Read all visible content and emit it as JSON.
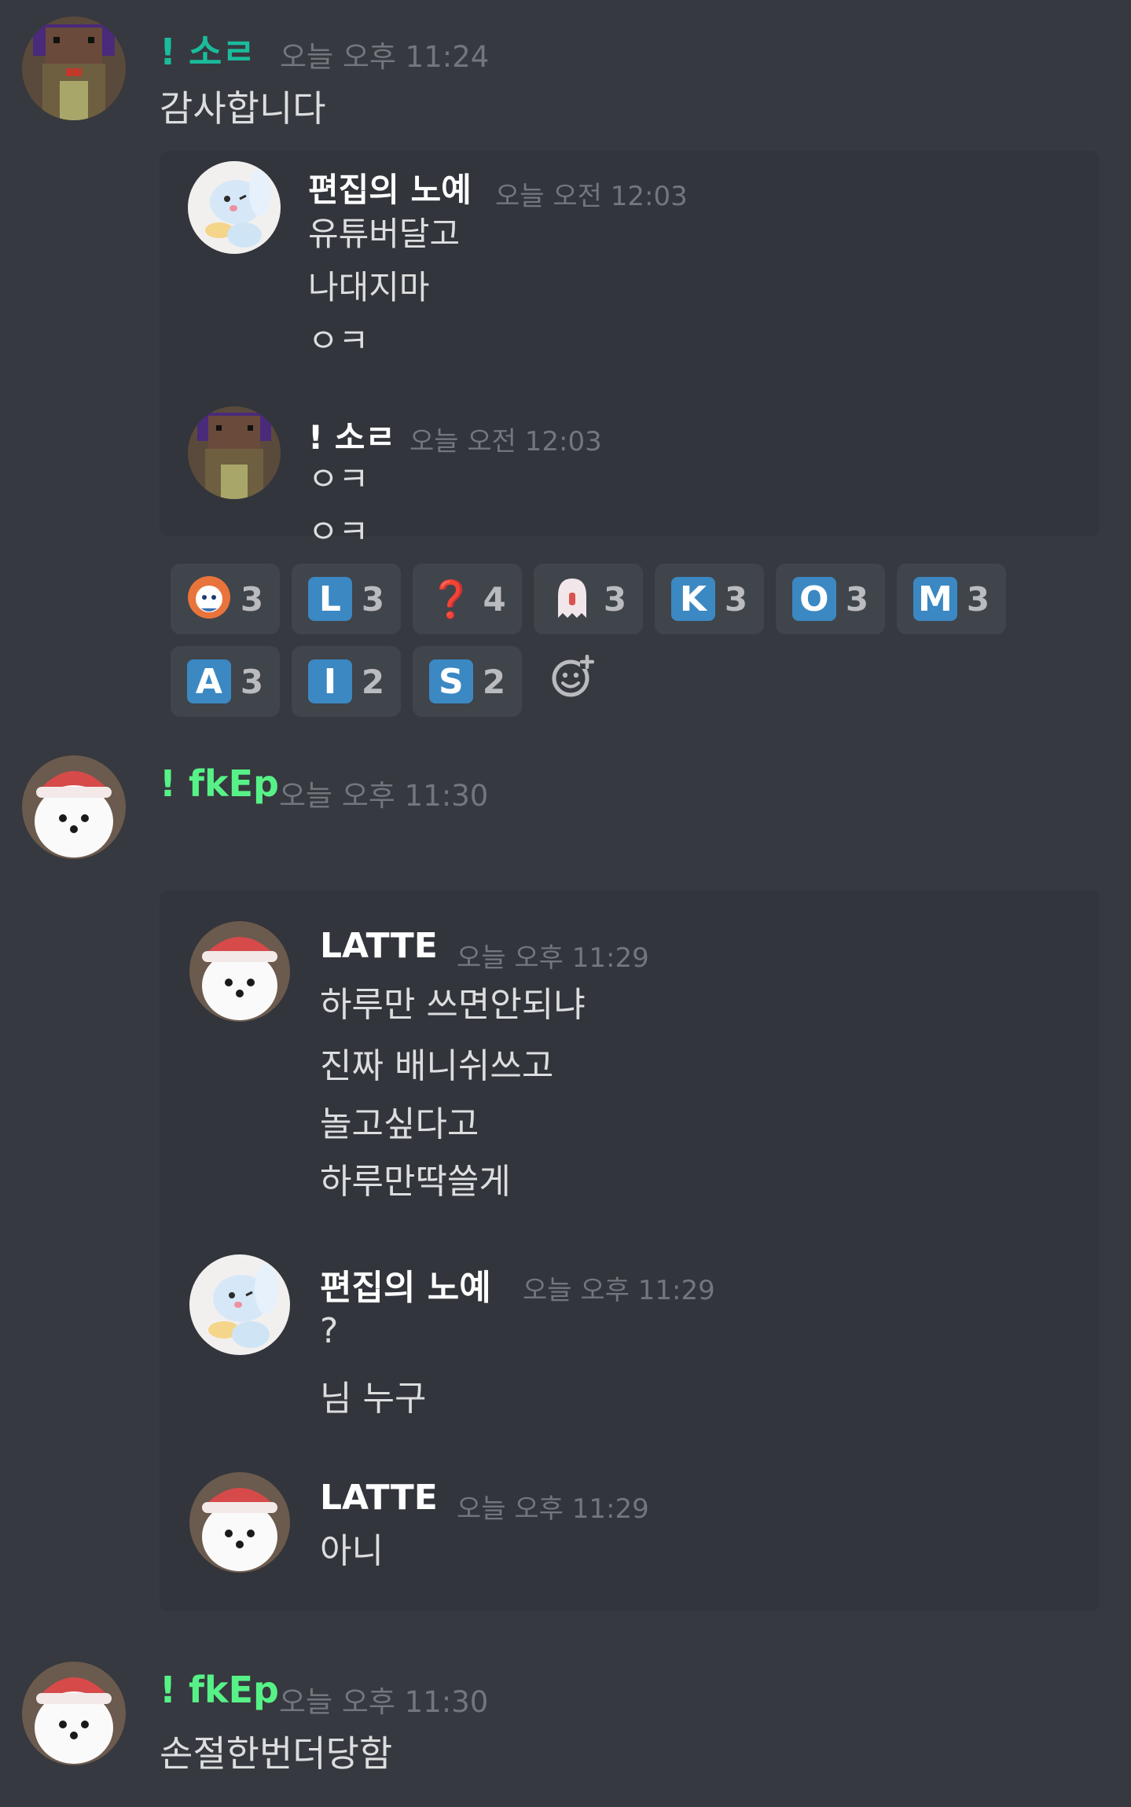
{
  "colors": {
    "background": "#36393f",
    "embed_bg": "#32353b",
    "reaction_bg": "#40444b",
    "timestamp": "#72767d",
    "text": "#dcddde",
    "white_name": "#ffffff",
    "sor_name": "#1abc9c",
    "fkep_name": "#57f287",
    "reaction_tile": "#3b88c3",
    "question_red": "#dd2e44"
  },
  "messages": [
    {
      "author": "! 소ㄹ",
      "timestamp": "오늘 오후 11:24",
      "lines": [
        "감사합니다"
      ],
      "avatar": "pixel-avatar"
    },
    {
      "author": "! fkEp",
      "timestamp": "오늘 오후 11:30",
      "lines": [],
      "avatar": "pomeranian-avatar"
    },
    {
      "author": "! fkEp",
      "timestamp": "오늘 오후 11:30",
      "lines": [
        "손절한번더당함"
      ],
      "avatar": "pomeranian-avatar"
    }
  ],
  "embed1": [
    {
      "author": "편집의 노예",
      "timestamp": "오늘 오전 12:03",
      "lines": [
        "유튜버달고",
        "나대지마",
        "ㅇㅋ"
      ]
    },
    {
      "author": "! 소ㄹ",
      "timestamp": "오늘 오전 12:03",
      "lines": [
        "ㅇㅋ",
        "ㅇㅋ"
      ]
    }
  ],
  "embed2": [
    {
      "author": "LATTE",
      "timestamp": "오늘 오후 11:29",
      "lines": [
        "하루만 쓰면안되냐",
        "진짜 배니쉬쓰고",
        "놀고싶다고",
        "하루만딱쓸게"
      ]
    },
    {
      "author": "편집의 노예",
      "timestamp": "오늘 오후 11:29",
      "lines": [
        "?",
        "님 누구"
      ]
    },
    {
      "author": "LATTE",
      "timestamp": "오늘 오후 11:29",
      "lines": [
        "아니"
      ]
    }
  ],
  "reactions": [
    {
      "emoji": "avatar-face",
      "count": "3"
    },
    {
      "emoji": "L",
      "count": "3"
    },
    {
      "emoji": "❓",
      "count": "4"
    },
    {
      "emoji": "ghost-face",
      "count": "3"
    },
    {
      "emoji": "K",
      "count": "3"
    },
    {
      "emoji": "O",
      "count": "3"
    },
    {
      "emoji": "M",
      "count": "3"
    },
    {
      "emoji": "A",
      "count": "3"
    },
    {
      "emoji": "I",
      "count": "2"
    },
    {
      "emoji": "S",
      "count": "2"
    }
  ],
  "add_reaction_icon": "add-reaction-icon"
}
